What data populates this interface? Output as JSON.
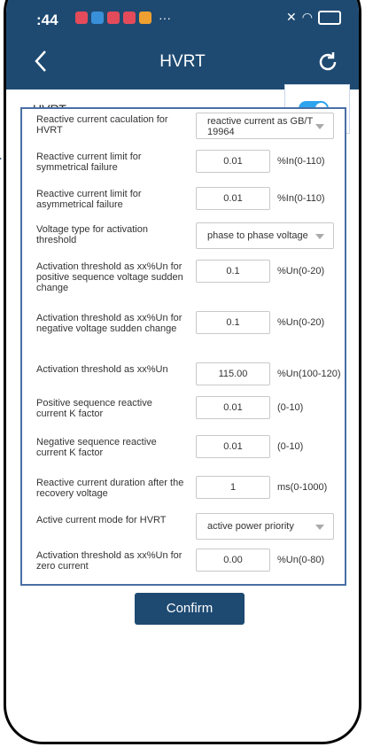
{
  "statusbar": {
    "time": ":44",
    "dots": "···"
  },
  "header": {
    "title": "HVRT",
    "back_icon": "chevron-left-icon",
    "refresh_icon": "refresh-icon"
  },
  "hvrt": {
    "label": "HVRT",
    "enabled": true,
    "accent": "#2ea4ef"
  },
  "rows": [
    {
      "label": "Reactive current caculation for HVRT",
      "type": "select",
      "value": "reactive current as GB/T 19964"
    },
    {
      "label": "Reactive current limit for symmetrical failure",
      "type": "input",
      "value": "0.01",
      "unit": "%In(0-110)"
    },
    {
      "label": "Reactive current limit for asymmetrical failure",
      "type": "input",
      "value": "0.01",
      "unit": "%In(0-110)"
    },
    {
      "label": "Voltage type for activation threshold",
      "type": "select",
      "value": "phase to phase voltage"
    },
    {
      "label": "Activation threshold as xx%Un for positive sequence voltage sudden change",
      "type": "input",
      "value": "0.1",
      "unit": "%Un(0-20)"
    },
    {
      "label": "Activation threshold as xx%Un for negative voltage sudden change",
      "type": "input",
      "value": "0.1",
      "unit": "%Un(0-20)"
    },
    {
      "label": "Activation threshold as xx%Un",
      "type": "input",
      "value": "115.00",
      "unit": "%Un(100-120)"
    },
    {
      "label": "Positive sequence reactive current K factor",
      "type": "input",
      "value": "0.01",
      "unit": "(0-10)"
    },
    {
      "label": "Negative sequence reactive current K factor",
      "type": "input",
      "value": "0.01",
      "unit": "(0-10)"
    },
    {
      "label": "Reactive current duration after the recovery voltage",
      "type": "input",
      "value": "1",
      "unit": "ms(0-1000)"
    },
    {
      "label": "Active current mode for HVRT",
      "type": "select",
      "value": "active power priority"
    },
    {
      "label": "Activation threshold as xx%Un for zero current",
      "type": "input",
      "value": "0.00",
      "unit": "%Un(0-80)"
    }
  ],
  "confirm_label": "Confirm",
  "colors": {
    "primary": "#1e4a72",
    "panel_border": "#4a6fa5"
  }
}
